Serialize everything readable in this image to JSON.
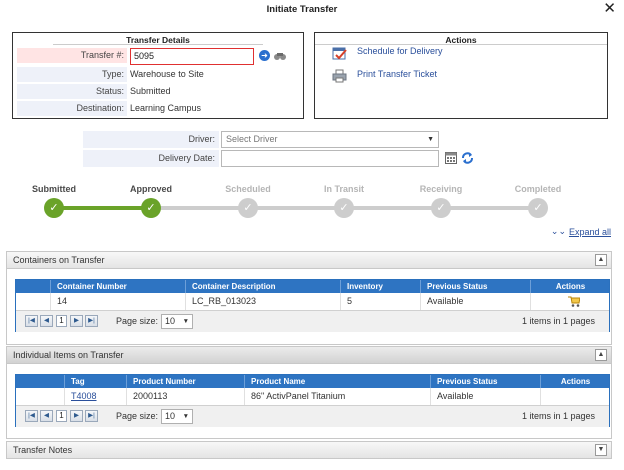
{
  "window": {
    "title": "Initiate Transfer"
  },
  "transfer_details": {
    "title": "Transfer Details",
    "fields": [
      {
        "label": "Transfer #:",
        "value": "5095"
      },
      {
        "label": "Type:",
        "value": "Warehouse to Site"
      },
      {
        "label": "Status:",
        "value": "Submitted"
      },
      {
        "label": "Destination:",
        "value": "Learning Campus"
      }
    ]
  },
  "actions": {
    "title": "Actions",
    "items": [
      {
        "label": "Schedule for Delivery",
        "icon": "calendar-check-icon"
      },
      {
        "label": "Print Transfer Ticket",
        "icon": "printer-icon"
      }
    ]
  },
  "driver": {
    "label": "Driver:",
    "placeholder": "Select Driver"
  },
  "delivery_date": {
    "label": "Delivery Date:",
    "value": ""
  },
  "progress": {
    "steps": [
      {
        "label": "Submitted",
        "state": "done"
      },
      {
        "label": "Approved",
        "state": "done"
      },
      {
        "label": "Scheduled",
        "state": "pending"
      },
      {
        "label": "In Transit",
        "state": "pending"
      },
      {
        "label": "Receiving",
        "state": "pending"
      },
      {
        "label": "Completed",
        "state": "pending"
      }
    ],
    "colors": {
      "done": "#6aa329",
      "pending": "#cdcdcd",
      "done_label": "#4a4a4a",
      "pending_label": "#b5b5b5"
    }
  },
  "expand_all": "Expand all",
  "containers": {
    "title": "Containers on Transfer",
    "columns": [
      "Container Number",
      "Container Description",
      "Inventory",
      "Previous Status",
      "Actions"
    ],
    "rows": [
      {
        "number": "14",
        "description": "LC_RB_013023",
        "inventory": "5",
        "previous_status": "Available",
        "action_icon": "cart-icon"
      }
    ],
    "pager": {
      "page": "1",
      "page_size_label": "Page size:",
      "page_size": "10",
      "info": "1 items in 1 pages"
    }
  },
  "items": {
    "title": "Individual Items on Transfer",
    "columns": [
      "Tag",
      "Product Number",
      "Product Name",
      "Previous Status",
      "Actions"
    ],
    "rows": [
      {
        "tag": "T4008",
        "product_number": "2000113",
        "product_name": "86\" ActivPanel Titanium",
        "previous_status": "Available"
      }
    ],
    "pager": {
      "page": "1",
      "page_size_label": "Page size:",
      "page_size": "10",
      "info": "1 items in 1 pages"
    }
  },
  "notes": {
    "title": "Transfer Notes"
  }
}
